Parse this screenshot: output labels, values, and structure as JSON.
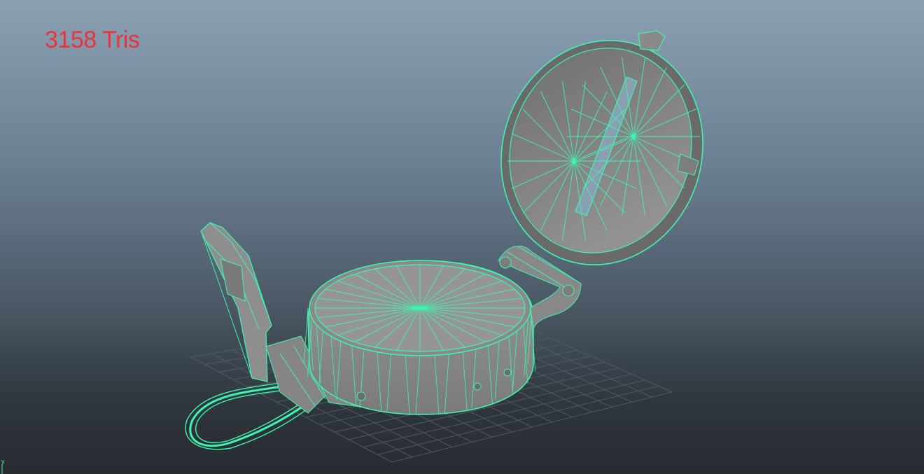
{
  "viewport": {
    "poly_count_label": "3158 Tris",
    "axis_label": "y"
  },
  "colors": {
    "background_top": "#8ca0b4",
    "background_bottom": "#262b30",
    "wireframe": "#3df5b0",
    "mesh_fill": "#8c8c8c",
    "grid": "#555c63",
    "label": "#e8353b"
  }
}
